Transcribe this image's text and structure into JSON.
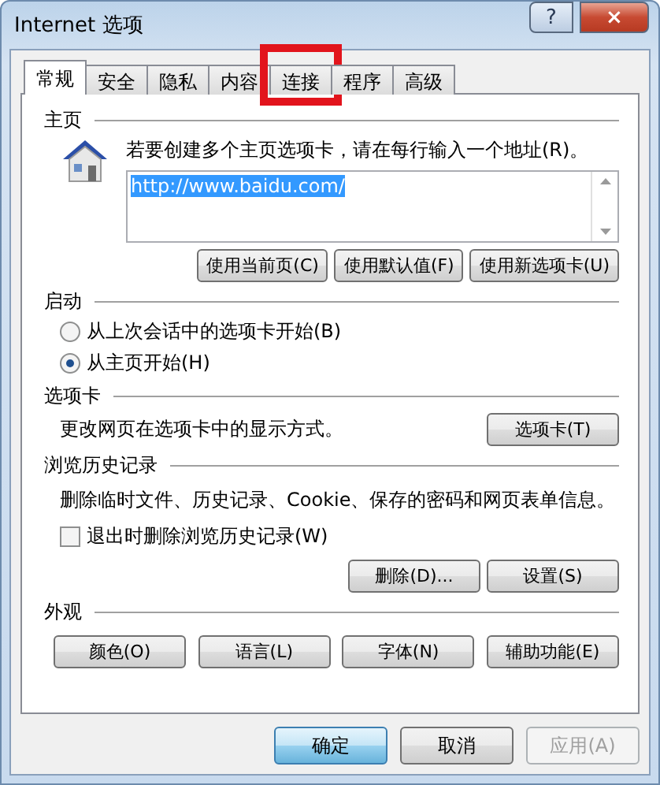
{
  "window": {
    "title": "Internet 选项",
    "help_button": "?",
    "close_button": "×"
  },
  "tabs": [
    {
      "label": "常规",
      "selected": true,
      "highlighted": false
    },
    {
      "label": "安全",
      "selected": false,
      "highlighted": false
    },
    {
      "label": "隐私",
      "selected": false,
      "highlighted": false
    },
    {
      "label": "内容",
      "selected": false,
      "highlighted": false
    },
    {
      "label": "连接",
      "selected": false,
      "highlighted": true
    },
    {
      "label": "程序",
      "selected": false,
      "highlighted": false
    },
    {
      "label": "高级",
      "selected": false,
      "highlighted": false
    }
  ],
  "home_page": {
    "heading": "主页",
    "instruction": "若要创建多个主页选项卡，请在每行输入一个地址(R)。",
    "address": "http://www.baidu.com/",
    "address_selected": true,
    "buttons": [
      "使用当前页(C)",
      "使用默认值(F)",
      "使用新选项卡(U)"
    ]
  },
  "startup": {
    "heading": "启动",
    "options": [
      {
        "label": "从上次会话中的选项卡开始(B)",
        "selected": false
      },
      {
        "label": "从主页开始(H)",
        "selected": true
      }
    ]
  },
  "tabs_section": {
    "heading": "选项卡",
    "description": "更改网页在选项卡中的显示方式。",
    "button": "选项卡(T)"
  },
  "history": {
    "heading": "浏览历史记录",
    "description": "删除临时文件、历史记录、Cookie、保存的密码和网页表单信息。",
    "checkbox": {
      "label": "退出时删除浏览历史记录(W)",
      "checked": false
    },
    "buttons": [
      "删除(D)...",
      "设置(S)"
    ]
  },
  "appearance": {
    "heading": "外观",
    "buttons": [
      "颜色(O)",
      "语言(L)",
      "字体(N)",
      "辅助功能(E)"
    ]
  },
  "footer": [
    {
      "label": "确定",
      "kind": "default",
      "disabled": false
    },
    {
      "label": "取消",
      "kind": "normal",
      "disabled": false
    },
    {
      "label": "应用(A)",
      "kind": "normal",
      "disabled": true
    }
  ]
}
